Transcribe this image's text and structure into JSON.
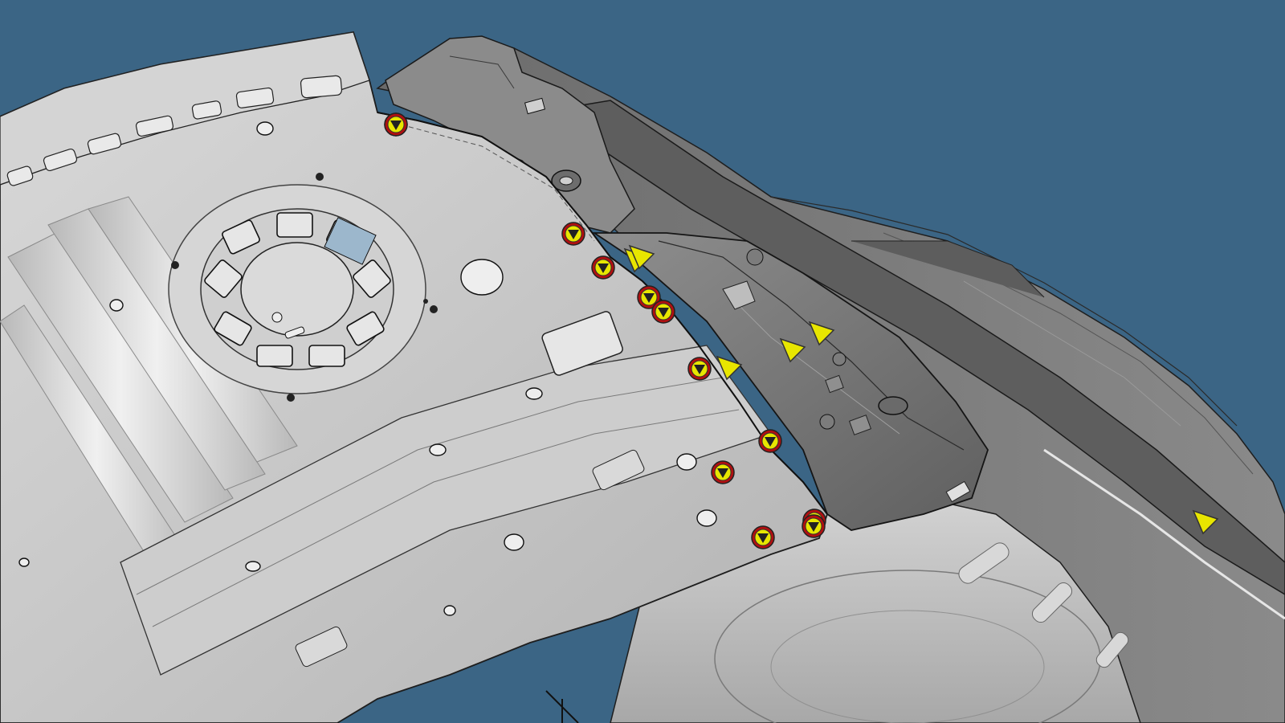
{
  "viewport": {
    "background_color": "#3b6585",
    "part_colors": {
      "floor_panel": "#c6c6c6",
      "floor_highlight": "#e4e4e4",
      "rear_panel": "#cfcfcf",
      "bracket_dark": "#6d6d6d",
      "bracket_mid": "#8a8a8a",
      "outer_panel": "#7b7b7b",
      "wheelhouse": "#b9b9b9",
      "edge_line": "#1e1e1e"
    }
  },
  "markers": {
    "types": [
      {
        "name": "weld-point",
        "fill_color": "#e8e600",
        "ring_color": "#b01010",
        "icon": "circle-triangle"
      },
      {
        "name": "locator",
        "fill_color": "#e8e600",
        "ring_color": "#333333",
        "icon": "triangle"
      }
    ],
    "weld_point_count": 12,
    "locator_count": 6
  }
}
